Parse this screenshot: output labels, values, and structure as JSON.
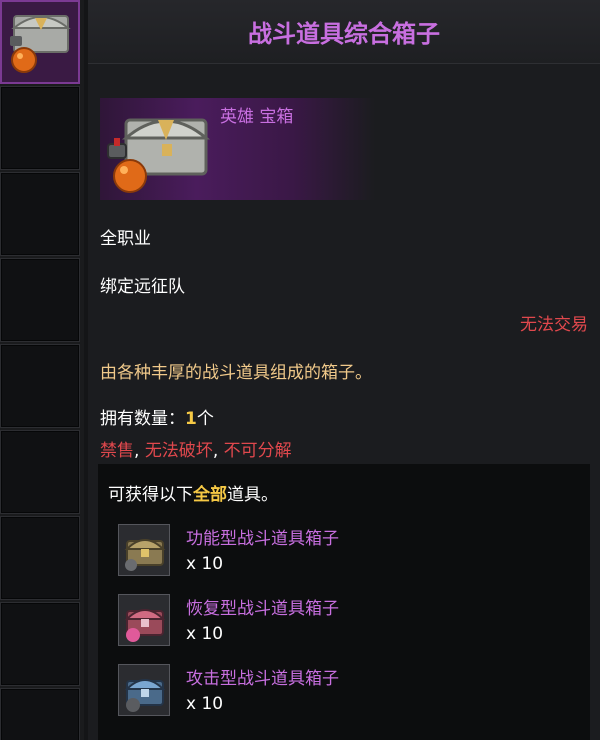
{
  "tooltip": {
    "title": "战斗道具综合箱子",
    "grade_type": "英雄 宝箱",
    "class_req": "全职业",
    "bind": "绑定远征队",
    "trade": "无法交易",
    "description": "由各种丰厚的战斗道具组成的箱子。",
    "owned_label": "拥有数量：",
    "owned_count": "1",
    "owned_unit": "个",
    "restrictions": [
      {
        "text": "禁售",
        "sep": ", "
      },
      {
        "text": "无法破坏",
        "sep": ", "
      },
      {
        "text": "不可分解",
        "sep": ""
      }
    ],
    "contents_prefix": "可获得以下",
    "contents_highlight": "全部",
    "contents_suffix": "道具。",
    "rewards": [
      {
        "name": "功能型战斗道具箱子",
        "count": "x 10",
        "icon": "gold-chest-icon"
      },
      {
        "name": "恢复型战斗道具箱子",
        "count": "x 10",
        "icon": "red-chest-icon"
      },
      {
        "name": "攻击型战斗道具箱子",
        "count": "x 10",
        "icon": "blue-chest-icon"
      }
    ]
  },
  "colors": {
    "title_purple": "#c86fe0",
    "warning_red": "#e0484d",
    "desc_gold": "#f0c98a",
    "highlight_gold": "#f6c945"
  }
}
